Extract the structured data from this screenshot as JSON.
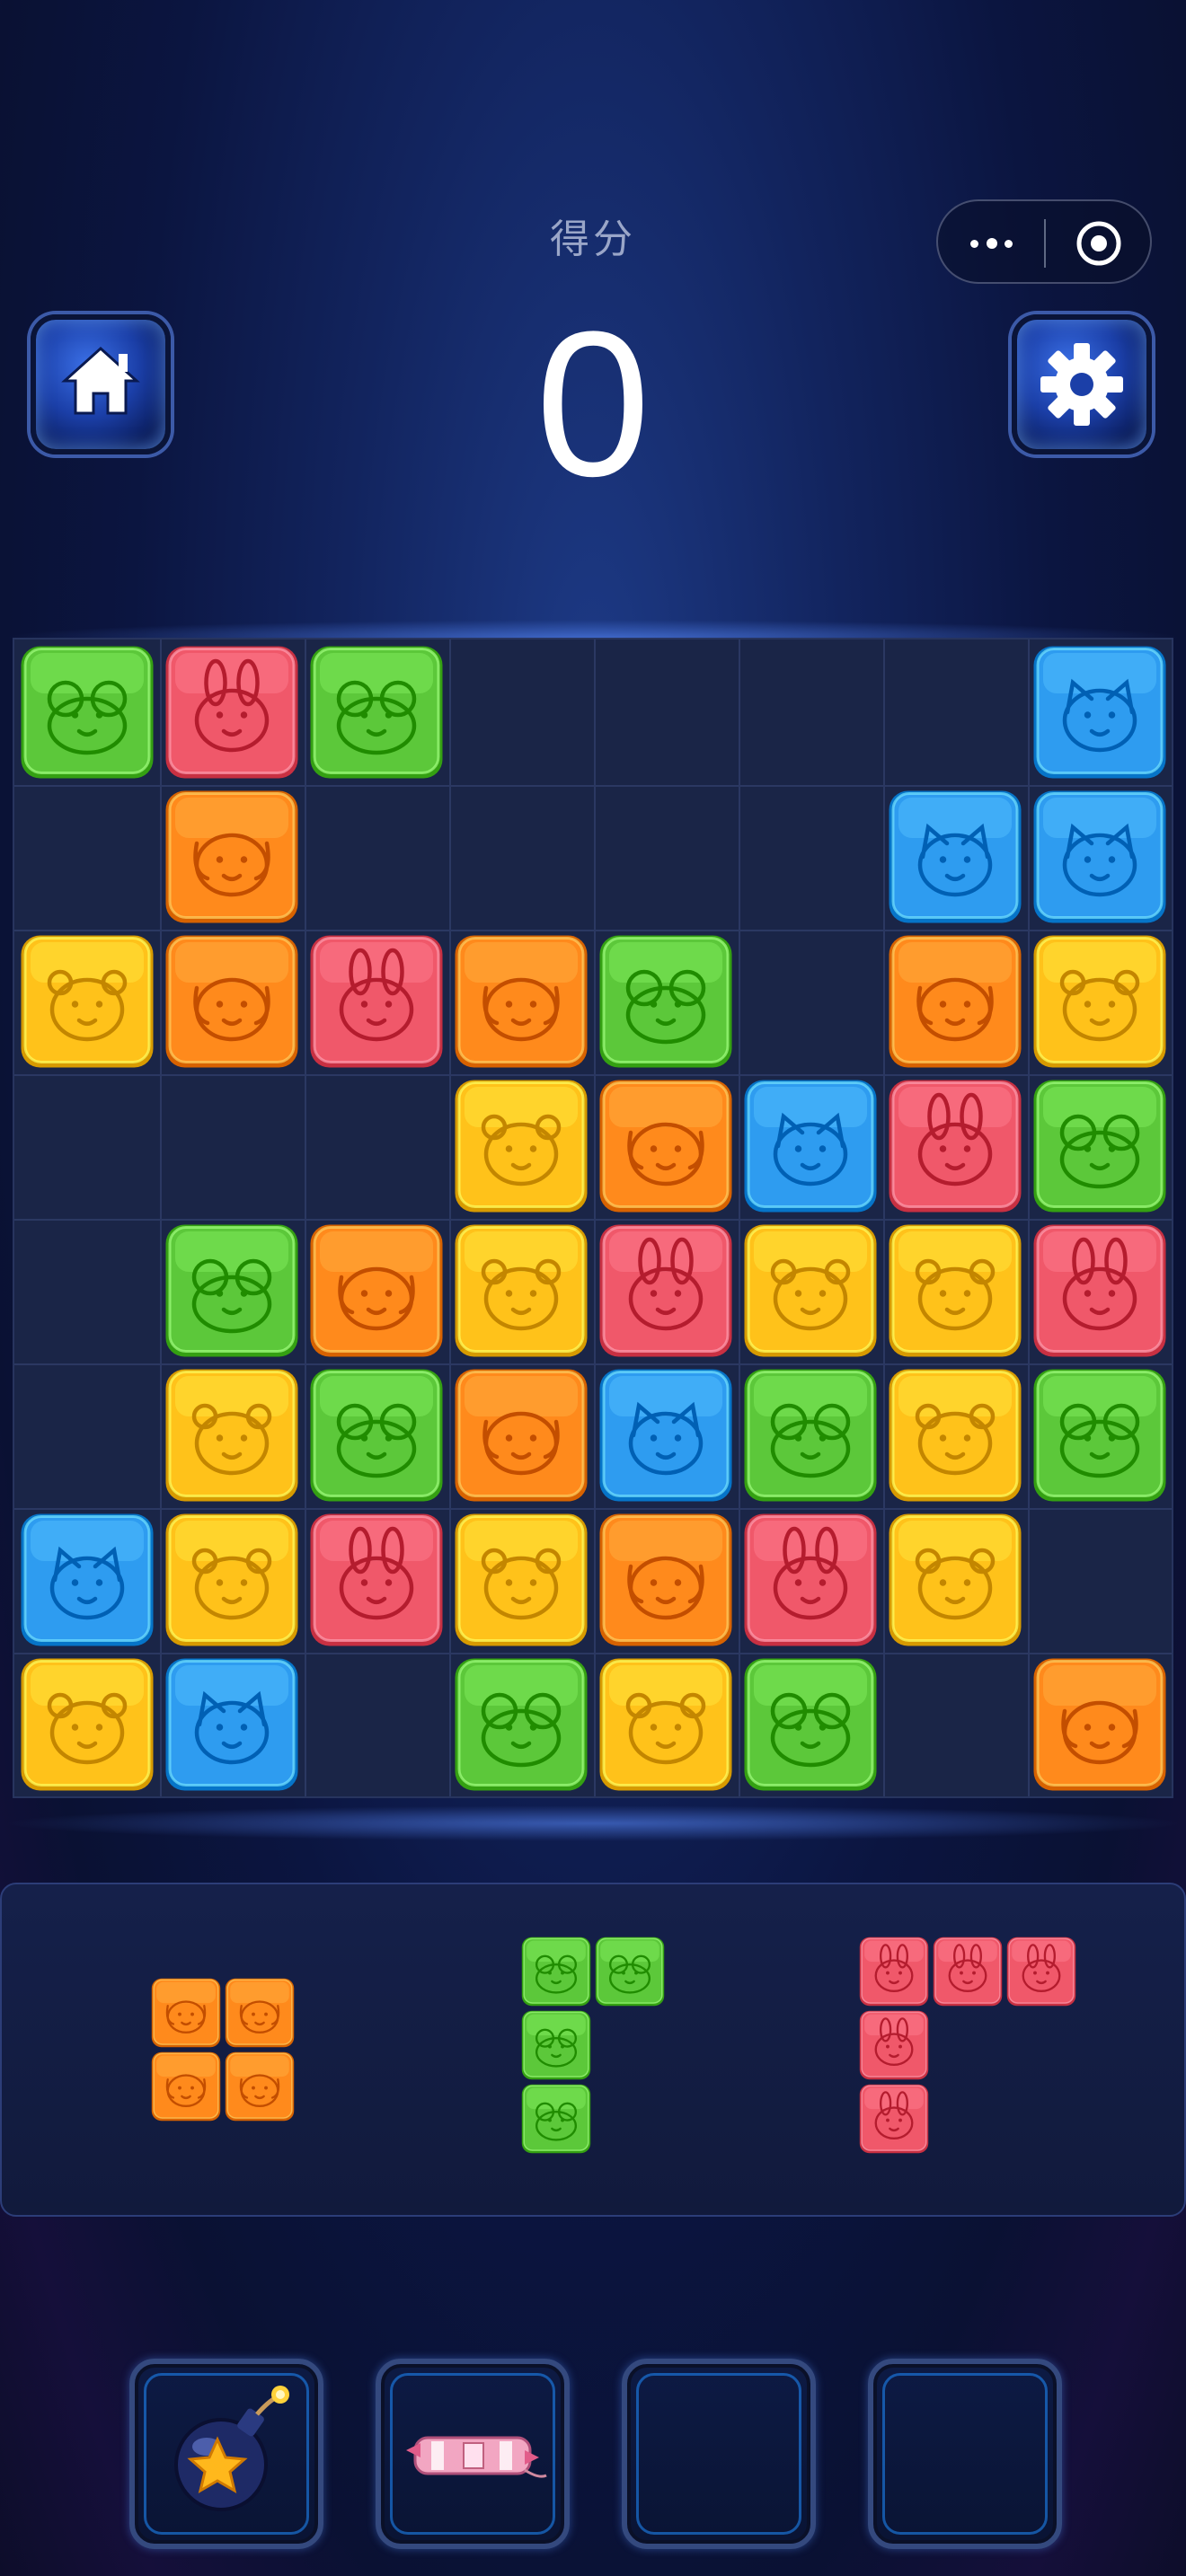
{
  "header": {
    "score_label": "得分",
    "score_value": "0",
    "home_button_icon": "home-icon",
    "settings_button_icon": "gear-icon",
    "menu_capsule": {
      "more_icon": "more-dots-icon",
      "close_icon": "target-close-icon"
    }
  },
  "colors": {
    "green": "#5cc83a",
    "red": "#f0586a",
    "orange": "#ff8a1c",
    "yellow": "#ffc21a",
    "blue": "#2e9cf0"
  },
  "board": {
    "rows": 8,
    "cols": 8,
    "cells": [
      [
        "green-frog",
        "red-rabbit",
        "green-frog",
        "",
        "",
        "",
        "",
        "blue-cat"
      ],
      [
        "",
        "orange-dog",
        "",
        "",
        "",
        "",
        "blue-cat",
        "blue-cat"
      ],
      [
        "yellow-bear",
        "orange-dog",
        "red-rabbit",
        "orange-dog",
        "green-frog",
        "",
        "orange-dog",
        "yellow-bear"
      ],
      [
        "",
        "",
        "",
        "yellow-bear",
        "orange-dog",
        "blue-cat",
        "red-rabbit",
        "green-frog"
      ],
      [
        "",
        "green-frog",
        "orange-dog",
        "yellow-bear",
        "red-rabbit",
        "yellow-bear",
        "yellow-bear",
        "red-rabbit"
      ],
      [
        "",
        "yellow-bear",
        "green-frog",
        "orange-dog",
        "blue-cat",
        "green-frog",
        "yellow-bear",
        "green-frog"
      ],
      [
        "blue-cat",
        "yellow-bear",
        "red-rabbit",
        "yellow-bear",
        "orange-dog",
        "red-rabbit",
        "yellow-bear",
        ""
      ],
      [
        "yellow-bear",
        "blue-cat",
        "",
        "green-frog",
        "yellow-bear",
        "green-frog",
        "",
        "orange-dog"
      ]
    ]
  },
  "pieces": [
    {
      "name": "orange-square-piece",
      "kind": "orange-dog",
      "cells": [
        [
          0,
          0
        ],
        [
          0,
          1
        ],
        [
          1,
          0
        ],
        [
          1,
          1
        ]
      ]
    },
    {
      "name": "green-corner-piece",
      "kind": "green-frog",
      "cells": [
        [
          0,
          0
        ],
        [
          0,
          1
        ],
        [
          1,
          0
        ],
        [
          2,
          0
        ]
      ]
    },
    {
      "name": "red-corner-piece",
      "kind": "red-rabbit",
      "cells": [
        [
          0,
          0
        ],
        [
          0,
          1
        ],
        [
          0,
          2
        ],
        [
          1,
          0
        ],
        [
          2,
          0
        ]
      ]
    }
  ],
  "powerups": [
    {
      "name": "bomb-slot",
      "icon": "bomb-star-icon"
    },
    {
      "name": "firecracker-slot",
      "icon": "firecracker-icon"
    },
    {
      "name": "empty-slot-3",
      "icon": ""
    },
    {
      "name": "empty-slot-4",
      "icon": ""
    }
  ]
}
